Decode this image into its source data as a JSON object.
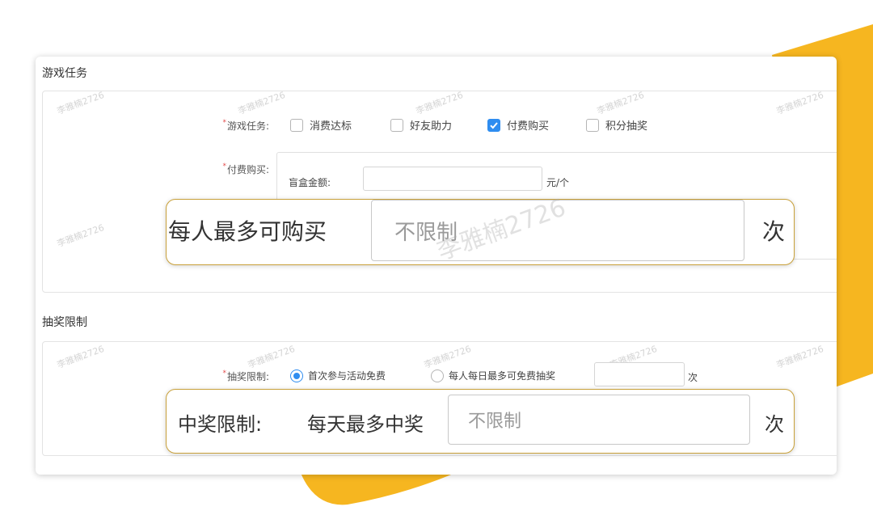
{
  "colors": {
    "accent_yellow": "#f6b620",
    "checkbox_blue": "#2f8df0",
    "callout_border": "#c9a13a",
    "required_red": "#e34a4a"
  },
  "watermark": "李雅楠2726",
  "game_tasks": {
    "section_title": "游戏任务",
    "tasks_label": "游戏任务:",
    "options": [
      {
        "label": "消费达标",
        "checked": false
      },
      {
        "label": "好友助力",
        "checked": false
      },
      {
        "label": "付费购买",
        "checked": true
      },
      {
        "label": "积分抽奖",
        "checked": false
      }
    ],
    "paid_label": "付费购买:",
    "box_amount_label": "盲盒金额:",
    "box_amount_unit": "元/个",
    "purchase_limit_label": "每人最多可购买",
    "purchase_limit_placeholder": "不限制",
    "purchase_limit_unit": "次"
  },
  "draw_limit": {
    "section_title": "抽奖限制",
    "label": "抽奖限制:",
    "option_first_free": "首次参与活动免费",
    "option_daily_free": "每人每日最多可免费抽奖",
    "option_unit": "次",
    "prize_limit_label": "中奖限制:",
    "prize_daily_label": "每天最多中奖",
    "prize_daily_placeholder": "不限制",
    "prize_daily_unit": "次"
  }
}
